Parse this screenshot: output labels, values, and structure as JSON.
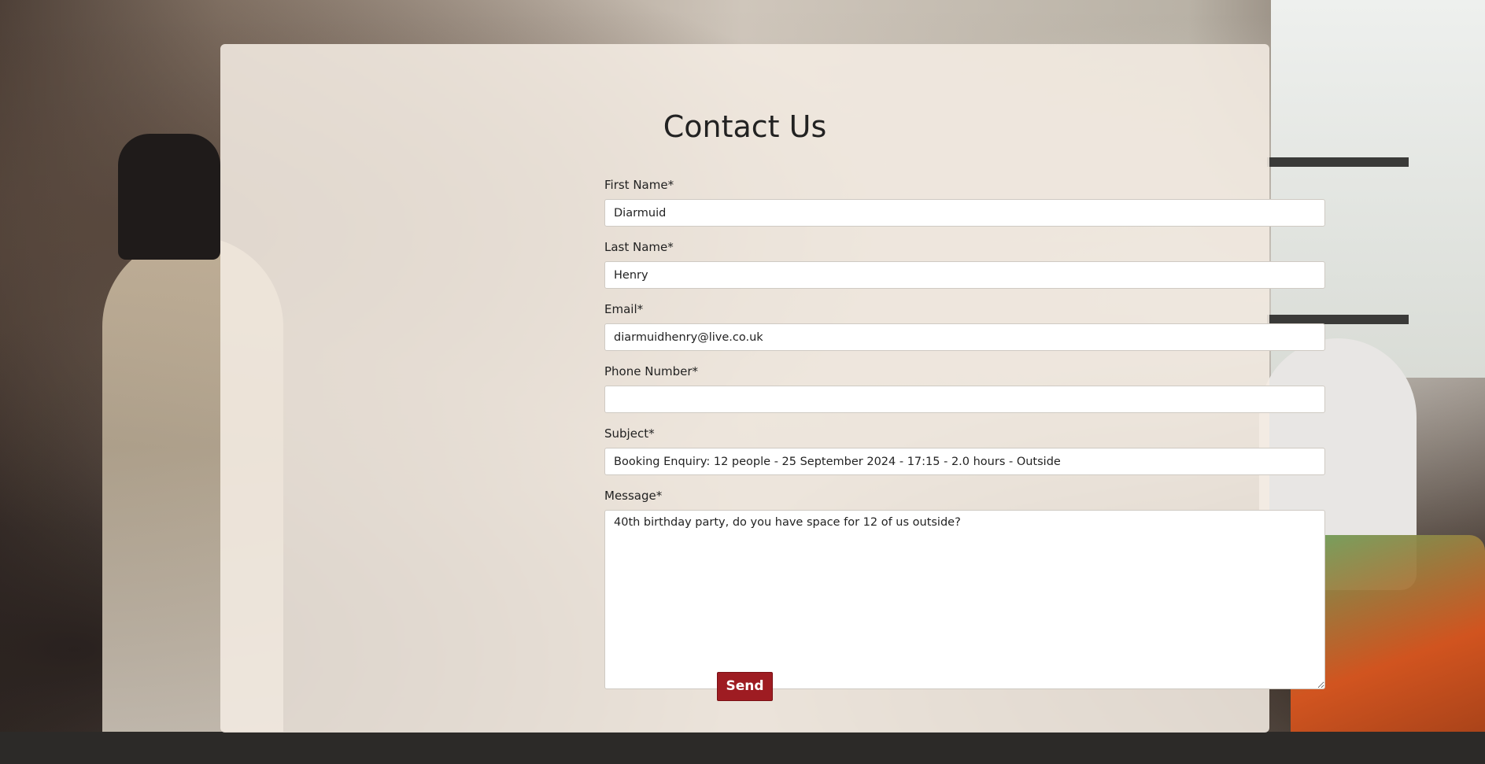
{
  "page": {
    "title": "Contact Us"
  },
  "form": {
    "first_name": {
      "label": "First Name*",
      "value": "Diarmuid"
    },
    "last_name": {
      "label": "Last Name*",
      "value": "Henry"
    },
    "email": {
      "label": "Email*",
      "value": "diarmuidhenry@live.co.uk"
    },
    "phone": {
      "label": "Phone Number*",
      "value": ""
    },
    "subject": {
      "label": "Subject*",
      "value": "Booking Enquiry: 12 people - 25 September 2024 - 17:15 - 2.0 hours - Outside"
    },
    "message": {
      "label": "Message*",
      "value": "40th birthday party, do you have space for 12 of us outside?"
    },
    "send_label": "Send"
  },
  "colors": {
    "button_bg": "#9e1c22",
    "card_bg": "#f4ece2"
  }
}
